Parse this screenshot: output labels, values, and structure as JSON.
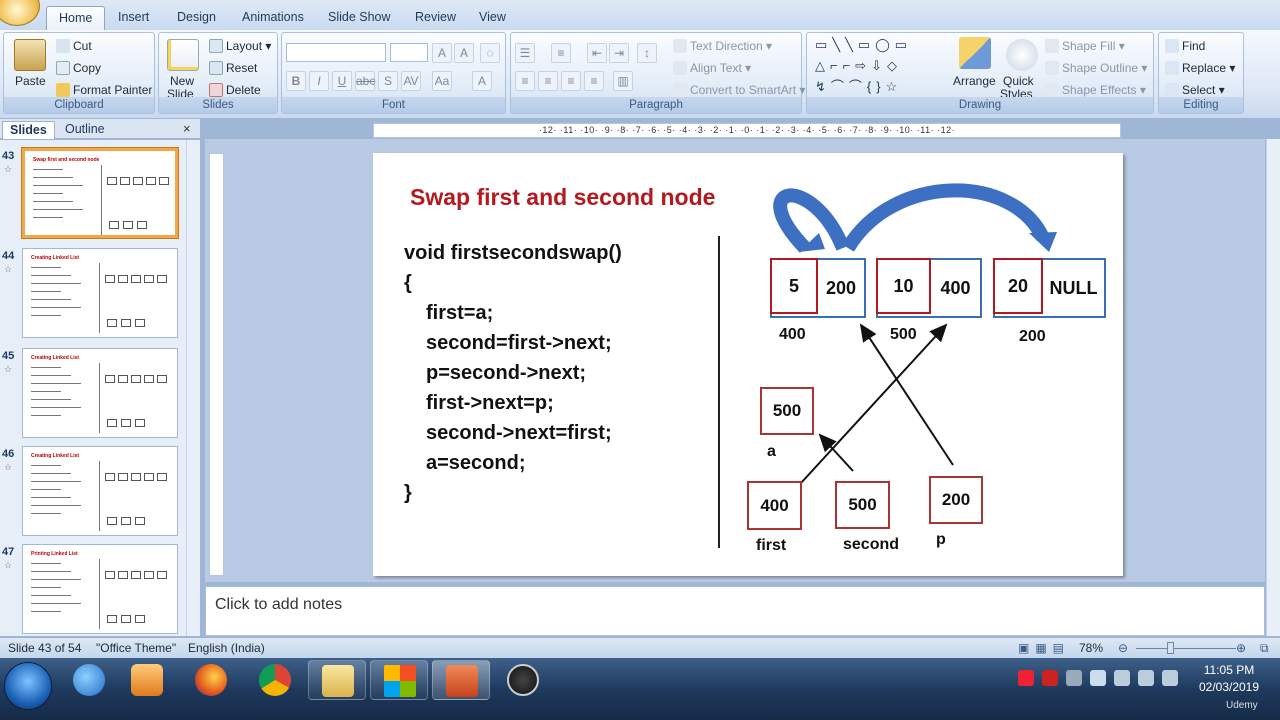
{
  "ribbon": {
    "tabs": [
      "Home",
      "Insert",
      "Design",
      "Animations",
      "Slide Show",
      "Review",
      "View"
    ],
    "clipboard": {
      "title": "Clipboard",
      "paste": "Paste",
      "cut": "Cut",
      "copy": "Copy",
      "format_painter": "Format Painter"
    },
    "slides": {
      "title": "Slides",
      "new_slide": "New",
      "new_slide2": "Slide",
      "layout": "Layout",
      "reset": "Reset",
      "delete": "Delete"
    },
    "font": {
      "title": "Font"
    },
    "paragraph": {
      "title": "Paragraph",
      "text_direction": "Text Direction",
      "align_text": "Align Text",
      "convert": "Convert to SmartArt"
    },
    "drawing": {
      "title": "Drawing",
      "arrange": "Arrange",
      "quick": "Quick",
      "styles": "Styles",
      "shape_fill": "Shape Fill",
      "shape_outline": "Shape Outline",
      "shape_effects": "Shape Effects"
    },
    "editing": {
      "title": "Editing",
      "find": "Find",
      "replace": "Replace",
      "select": "Select"
    }
  },
  "panel": {
    "tab_slides": "Slides",
    "tab_outline": "Outline",
    "close": "×",
    "thumbs": [
      {
        "num": "43",
        "title": "Swap first and second node",
        "selected": true
      },
      {
        "num": "44",
        "title": "Creating Linked List",
        "selected": false
      },
      {
        "num": "45",
        "title": "Creating Linked List",
        "selected": false
      },
      {
        "num": "46",
        "title": "Creating Linked List",
        "selected": false
      },
      {
        "num": "47",
        "title": "Printing Linked List",
        "selected": false
      }
    ]
  },
  "ruler": {
    "h": "·12·  ·11·  ·10·  ·9·  ·8·  ·7·  ·6·  ·5·  ·4·  ·3·  ·2·  ·1·  ·0·  ·1·  ·2·  ·3·  ·4·  ·5·  ·6·  ·7·  ·8·  ·9·  ·10·  ·11·  ·12·"
  },
  "slide": {
    "title": "Swap first and second node",
    "code": [
      "void firstsecondswap()",
      "{",
      "first=a;",
      "second=first->next;",
      "p=second->next;",
      "first->next=p;",
      "second->next=first;",
      "a=second;",
      "}"
    ],
    "nodes": [
      {
        "data": "5",
        "next": "200",
        "addr": "400"
      },
      {
        "data": "10",
        "next": "400",
        "addr": "500"
      },
      {
        "data": "20",
        "next": "NULL",
        "addr": "200"
      }
    ],
    "ptrs": [
      {
        "val": "500",
        "name": "a"
      },
      {
        "val": "400",
        "name": "first"
      },
      {
        "val": "500",
        "name": "second"
      },
      {
        "val": "200",
        "name": "p"
      }
    ]
  },
  "notes": {
    "placeholder": "Click to add notes"
  },
  "status": {
    "slide": "Slide 43 of 54",
    "theme": "\"Office Theme\"",
    "lang": "English (India)",
    "zoom": "78%"
  },
  "taskbar": {
    "time": "11:05 PM",
    "date": "02/03/2019",
    "watermark": "Udemy"
  },
  "colors": {
    "title_red": "#b3191f",
    "node_blue": "#3b6db3",
    "arrow_blue": "#3d6fc2"
  }
}
